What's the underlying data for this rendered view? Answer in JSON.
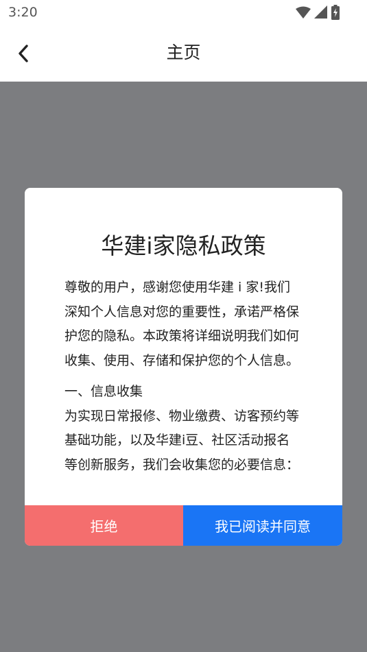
{
  "status_bar": {
    "time": "3:20",
    "icons": [
      "wifi-icon",
      "signal-icon",
      "battery-charging-icon"
    ]
  },
  "app_bar": {
    "back_icon": "chevron-left-icon",
    "title": "主页"
  },
  "dialog": {
    "title": "华建i家隐私政策",
    "paragraphs": [
      "尊敬的用户，感谢您使用华建 i 家!我们深知个人信息对您的重要性，承诺严格保护您的隐私。本政策将详细说明我们如何收集、使用、存储和保护您的个人信息。",
      "一、信息收集",
      "为实现日常报修、物业缴费、访客预约等基础功能，以及华建i豆、社区活动报名等创新服务，我们会收集您的必要信息："
    ],
    "reject_label": "拒绝",
    "agree_label": "我已阅读并同意"
  },
  "colors": {
    "overlay": "#7c7d80",
    "reject": "#f46e6e",
    "agree": "#1a75f5"
  }
}
